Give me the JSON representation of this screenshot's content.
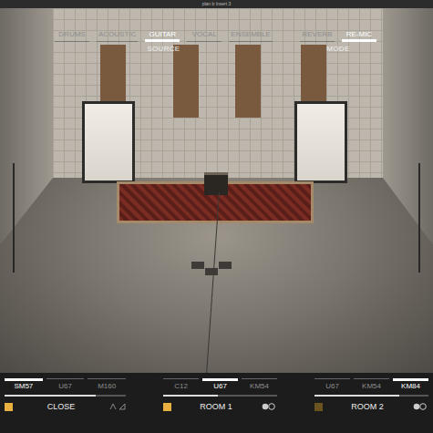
{
  "window": {
    "title": "plan b Insert 3"
  },
  "source": {
    "label": "SOURCE",
    "tabs": [
      {
        "label": "DRUMS",
        "selected": false
      },
      {
        "label": "ACOUSTIC",
        "selected": false
      },
      {
        "label": "GUITAR",
        "selected": true
      },
      {
        "label": "VOCAL",
        "selected": false
      },
      {
        "label": "ENSEMBLE",
        "selected": false
      }
    ]
  },
  "mode": {
    "label": "MODE",
    "tabs": [
      {
        "label": "REVERB",
        "selected": false
      },
      {
        "label": "RE-MIC",
        "selected": true
      }
    ]
  },
  "mics": [
    {
      "name": "CLOSE",
      "kind": "close",
      "enabled": true,
      "level": 0.75,
      "models": [
        {
          "label": "SM57",
          "selected": true
        },
        {
          "label": "U67",
          "selected": false
        },
        {
          "label": "M160",
          "selected": false
        }
      ]
    },
    {
      "name": "ROOM 1",
      "kind": "room",
      "enabled": true,
      "level": 0.48,
      "models": [
        {
          "label": "C12",
          "selected": false
        },
        {
          "label": "U67",
          "selected": true
        },
        {
          "label": "KM54",
          "selected": false
        }
      ]
    },
    {
      "name": "ROOM 2",
      "kind": "room",
      "enabled": false,
      "level": 0.74,
      "models": [
        {
          "label": "U67",
          "selected": false
        },
        {
          "label": "KM54",
          "selected": false
        },
        {
          "label": "KM84",
          "selected": true
        }
      ]
    }
  ]
}
